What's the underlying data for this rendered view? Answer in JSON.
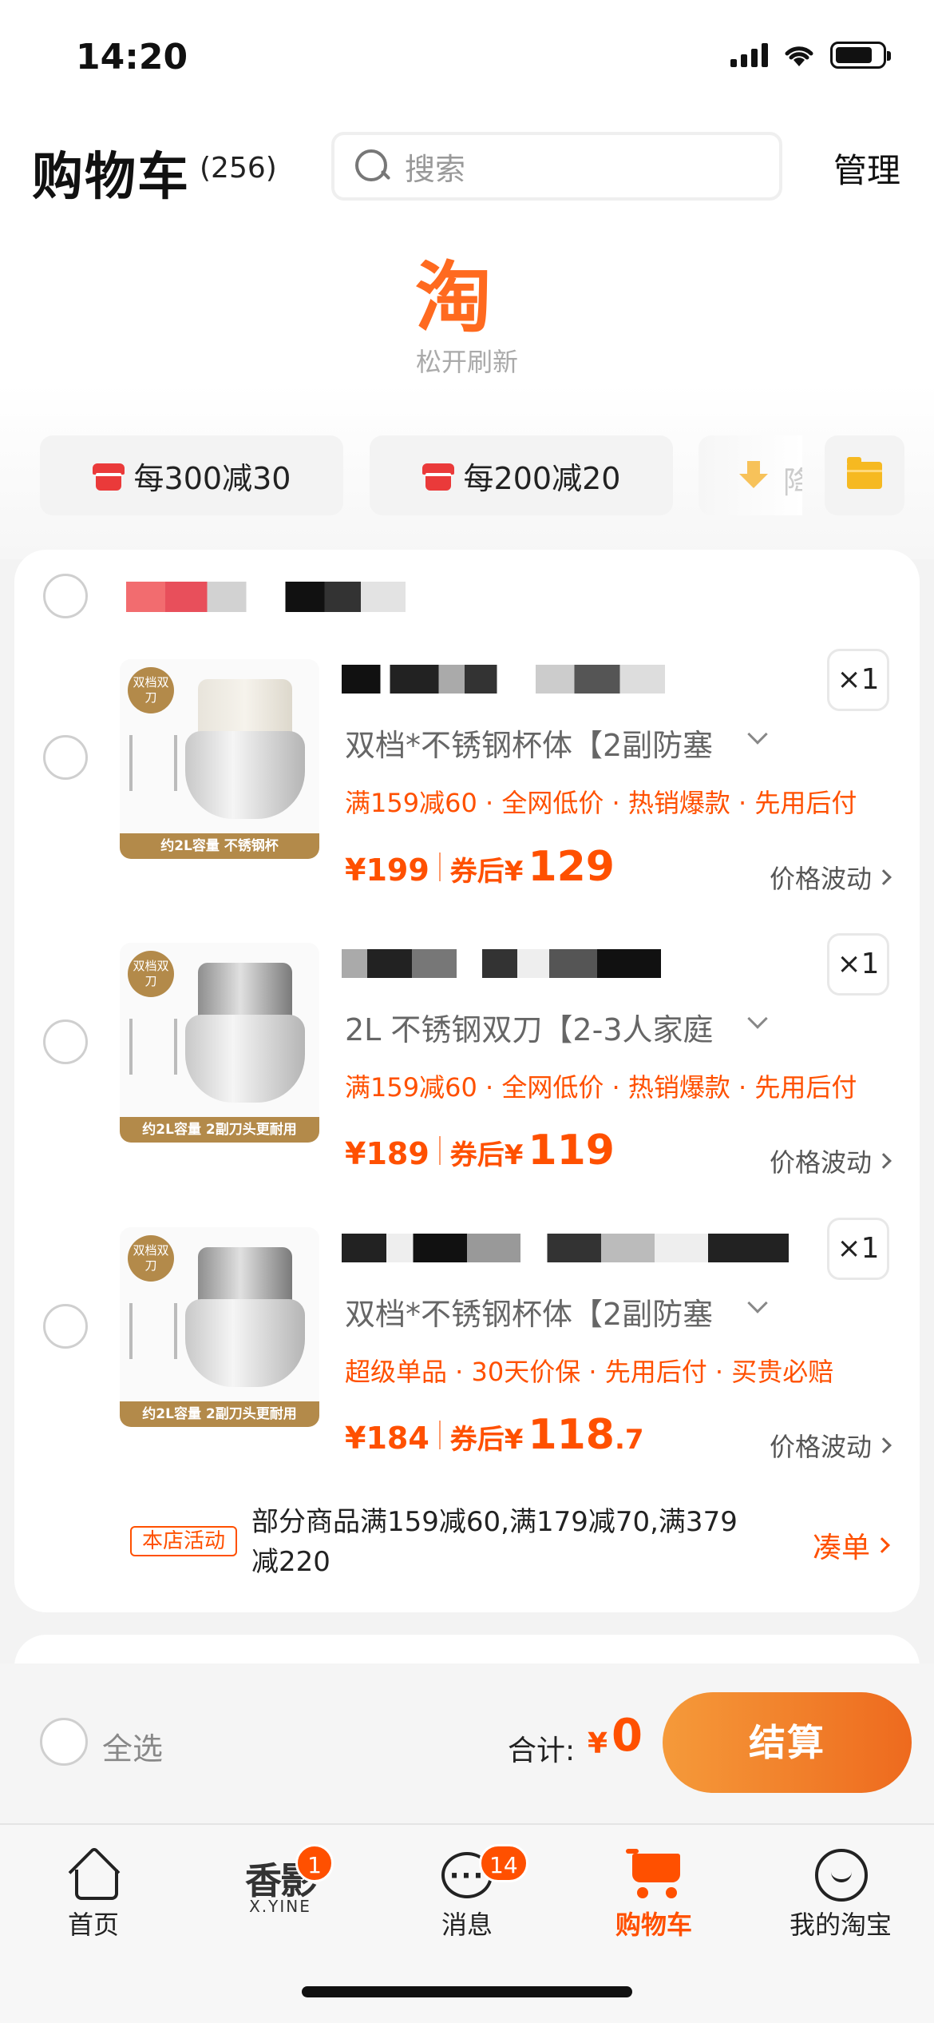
{
  "status_bar": {
    "time": "14:20"
  },
  "header": {
    "title": "购物车",
    "count": "(256)",
    "search_placeholder": "搜索",
    "manage_label": "管理"
  },
  "refresh": {
    "logo": "淘",
    "text": "松开刷新"
  },
  "filters": [
    {
      "label": "每300减30",
      "icon": "shop-coupon-icon"
    },
    {
      "label": "每200减20",
      "icon": "shop-coupon-icon"
    },
    {
      "label": "降",
      "icon": "price-drop-arrow-icon"
    }
  ],
  "folder_icon": "folder-icon",
  "store": {
    "activity_badge": "本店活动",
    "activity_text": "部分商品满159减60,满179减70,满379减220",
    "collect_label": "凑单"
  },
  "products": [
    {
      "image_tag": "双档双刀",
      "image_caption": "约2L容量 不锈钢杯",
      "quantity": "×1",
      "sku": "双档*不锈钢杯体【2副防塞",
      "promo": "满159减60 · 全网低价 · 热销爆款 · 先用后付",
      "price": "¥199",
      "after_label": "券后¥",
      "final_price": "129",
      "final_decimal": "",
      "wave_label": "价格波动"
    },
    {
      "image_tag": "双档双刀",
      "image_caption": "约2L容量 2副刀头更耐用",
      "quantity": "×1",
      "sku": "2L 不锈钢双刀【2-3人家庭",
      "promo": "满159减60 · 全网低价 · 热销爆款 · 先用后付",
      "price": "¥189",
      "after_label": "券后¥",
      "final_price": "119",
      "final_decimal": "",
      "wave_label": "价格波动"
    },
    {
      "image_tag": "双档双刀",
      "image_caption": "约2L容量 2副刀头更耐用",
      "quantity": "×1",
      "sku": "双档*不锈钢杯体【2副防塞",
      "promo": "超级单品 · 30天价保 · 先用后付 · 买贵必赔",
      "price": "¥184",
      "after_label": "券后¥",
      "final_price": "118",
      "final_decimal": ".7",
      "wave_label": "价格波动"
    }
  ],
  "checkout": {
    "select_all": "全选",
    "total_label": "合计:",
    "currency": "¥",
    "total_value": "0",
    "button_label": "结算"
  },
  "tabs": [
    {
      "label": "首页",
      "icon": "home-icon",
      "active": false
    },
    {
      "label": "",
      "icon": "xying-app-icon",
      "logo_text": "香影",
      "logo_sub": "X.YINE",
      "badge": "1",
      "active": false
    },
    {
      "label": "消息",
      "icon": "message-icon",
      "badge": "14",
      "active": false
    },
    {
      "label": "购物车",
      "icon": "cart-icon",
      "active": true
    },
    {
      "label": "我的淘宝",
      "icon": "smile-icon",
      "active": false
    }
  ],
  "colors": {
    "accent": "#ff5000",
    "checkout_gradient_start": "#f59a3a",
    "checkout_gradient_end": "#ee6a1e"
  }
}
